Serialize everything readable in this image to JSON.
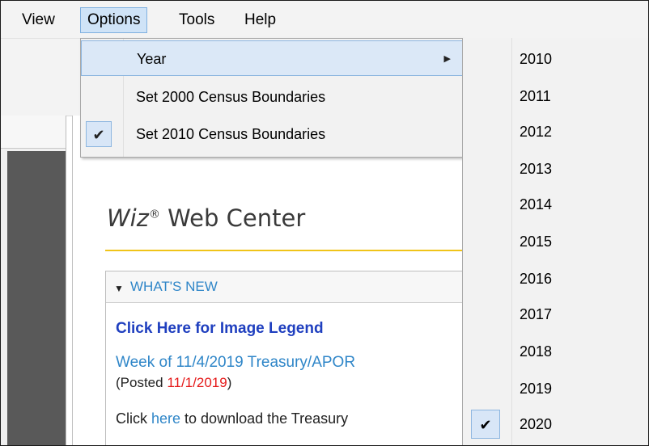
{
  "menubar": {
    "items": [
      {
        "label": "View"
      },
      {
        "label": "Options"
      },
      {
        "label": "Tools"
      },
      {
        "label": "Help"
      }
    ]
  },
  "options_menu": {
    "items": [
      {
        "label": "Year",
        "has_submenu": true,
        "highlighted": true
      },
      {
        "label": "Set 2000 Census Boundaries",
        "checked": false
      },
      {
        "label": "Set 2010 Census Boundaries",
        "checked": true
      }
    ],
    "check_glyph": "✔",
    "submenu_arrow_glyph": "▶"
  },
  "year_submenu": {
    "years": [
      "2010",
      "2011",
      "2012",
      "2013",
      "2014",
      "2015",
      "2016",
      "2017",
      "2018",
      "2019",
      "2020"
    ],
    "selected": "2020"
  },
  "web": {
    "brand_name": "Wiz",
    "brand_mark": "®",
    "brand_suffix": " Web Center",
    "accent_color": "#f0c419",
    "section_arrow": "▼",
    "section_title": "WHAT'S NEW",
    "legend_link": "Click Here for Image Legend",
    "week_text": "Week of 11/4/2019 Treasury/APOR",
    "posted_open": "(Posted ",
    "posted_date": "11/1/2019",
    "posted_close": ")",
    "download_prefix": "Click ",
    "download_link": "here",
    "download_suffix": " to download the Treasury"
  }
}
